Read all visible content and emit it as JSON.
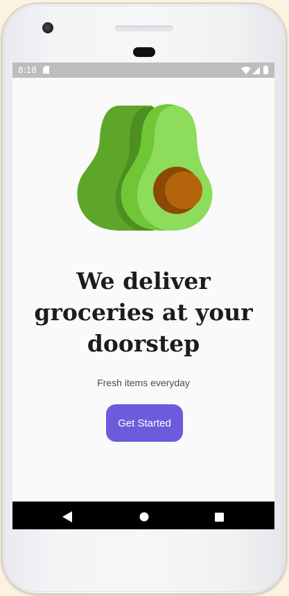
{
  "status_bar": {
    "time": "8:18",
    "icons": [
      "sd-card-icon",
      "wifi-icon",
      "cell-signal-icon",
      "battery-icon"
    ]
  },
  "illustration": {
    "icon": "avocado-icon",
    "colors": {
      "dark_green": "#5ea62a",
      "shadow_green": "#4d8f20",
      "mid_green": "#70c735",
      "light_green": "#8edc5c",
      "pit_shadow": "#8a4a06",
      "pit": "#b4650b"
    }
  },
  "content": {
    "headline_lines": [
      "We deliver",
      "groceries at your",
      "doorstep"
    ],
    "subtitle": "Fresh items everyday",
    "cta_label": "Get Started"
  },
  "nav_bar": {
    "icons": [
      "back-icon",
      "home-icon",
      "recents-icon"
    ]
  },
  "colors": {
    "accent": "#6c5cdc",
    "screen_background": "#fafafa",
    "status_bar": "#bdbdbd",
    "nav_bar": "#000000",
    "text_primary": "#1c1c1c",
    "text_secondary": "#4b4b4b"
  }
}
